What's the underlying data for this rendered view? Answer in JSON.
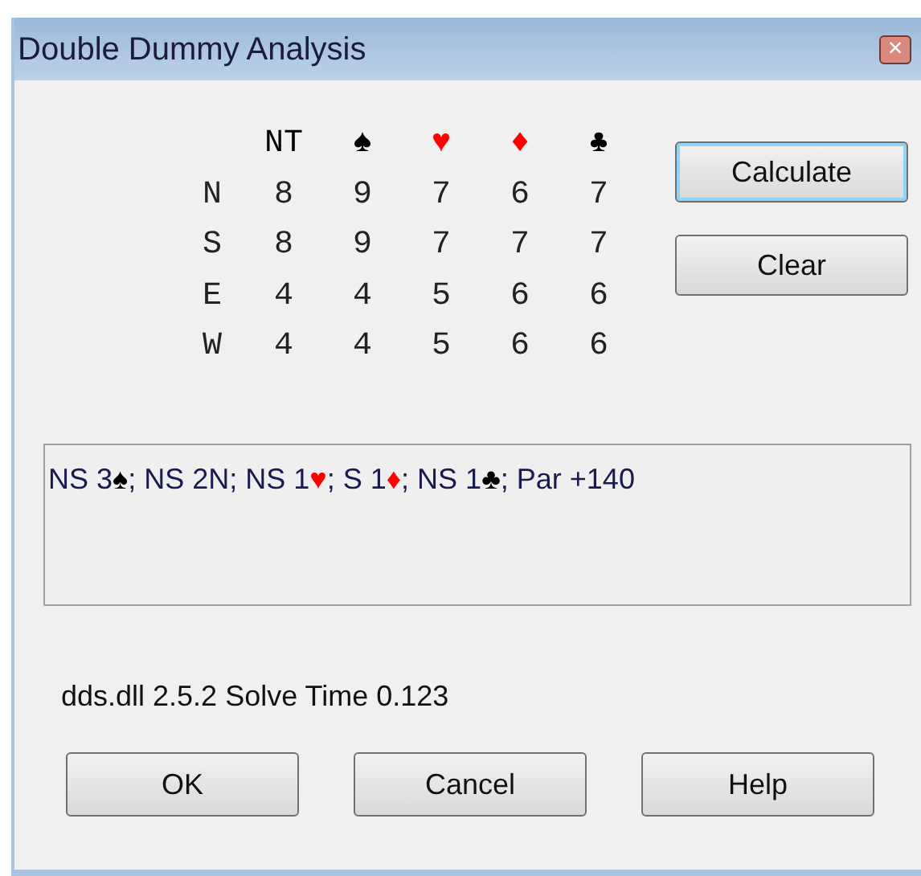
{
  "window": {
    "title": "Double Dummy Analysis",
    "close": "×"
  },
  "table": {
    "columns": [
      {
        "label": "NT",
        "color": "#000000"
      },
      {
        "label": "♠",
        "color": "#000000"
      },
      {
        "label": "♥",
        "color": "#ff0000"
      },
      {
        "label": "♦",
        "color": "#ff0000"
      },
      {
        "label": "♣",
        "color": "#000000"
      }
    ],
    "rows": [
      {
        "label": "N",
        "cells": [
          "8",
          "9",
          "7",
          "6",
          "7"
        ]
      },
      {
        "label": "S",
        "cells": [
          "8",
          "9",
          "7",
          "7",
          "7"
        ]
      },
      {
        "label": "E",
        "cells": [
          "4",
          "4",
          "5",
          "6",
          "6"
        ]
      },
      {
        "label": "W",
        "cells": [
          "4",
          "4",
          "5",
          "6",
          "6"
        ]
      }
    ]
  },
  "side_buttons": [
    {
      "label": "Calculate",
      "focused": true
    },
    {
      "label": "Clear",
      "focused": false
    }
  ],
  "result": [
    {
      "text": "NS 3",
      "color": "#1a1a50"
    },
    {
      "text": "♠",
      "color": "#000000"
    },
    {
      "text": "; NS 2N; NS 1",
      "color": "#1a1a50"
    },
    {
      "text": "♥",
      "color": "#ff0000"
    },
    {
      "text": "; S 1",
      "color": "#1a1a50"
    },
    {
      "text": "♦",
      "color": "#ff0000"
    },
    {
      "text": "; NS 1",
      "color": "#1a1a50"
    },
    {
      "text": "♣",
      "color": "#000000"
    },
    {
      "text": "; Par +140",
      "color": "#1a1a50"
    }
  ],
  "status": "dds.dll 2.5.2 Solve Time 0.123",
  "buttons": [
    "OK",
    "Cancel",
    "Help"
  ]
}
